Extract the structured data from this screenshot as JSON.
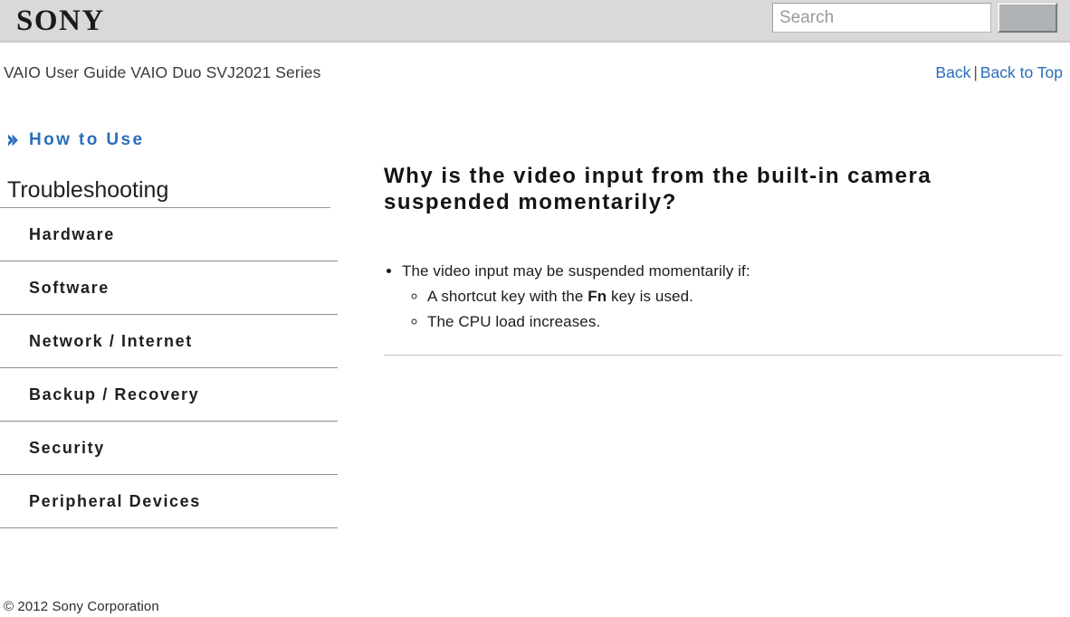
{
  "header": {
    "brand": "SONY",
    "search": {
      "placeholder": "Search",
      "value": "",
      "button_label": ""
    }
  },
  "subheader": {
    "guide_title": "VAIO User Guide VAIO Duo SVJ2021 Series",
    "links": {
      "back": "Back",
      "separator": "|",
      "back_to_top": "Back to Top"
    }
  },
  "sidebar": {
    "how_to_use": "How to Use",
    "section_title": "Troubleshooting",
    "items": [
      {
        "label": "Hardware"
      },
      {
        "label": "Software"
      },
      {
        "label": "Network / Internet"
      },
      {
        "label": "Backup / Recovery"
      },
      {
        "label": "Security"
      },
      {
        "label": "Peripheral Devices"
      }
    ]
  },
  "main": {
    "title": "Why is the video input from the built-in camera suspended momentarily?",
    "bullet": "The video input may be suspended momentarily if:",
    "sub_bullets": [
      {
        "pre": "A shortcut key with the ",
        "bold": "Fn",
        "post": " key is used."
      },
      {
        "pre": "The CPU load increases.",
        "bold": "",
        "post": ""
      }
    ]
  },
  "footer": {
    "copyright": "© 2012 Sony Corporation"
  },
  "colors": {
    "link_blue": "#2a6ebb",
    "header_gray": "#d9d9d9",
    "button_gray": "#b0b3b6",
    "rule_gray": "#8d8d8d"
  }
}
